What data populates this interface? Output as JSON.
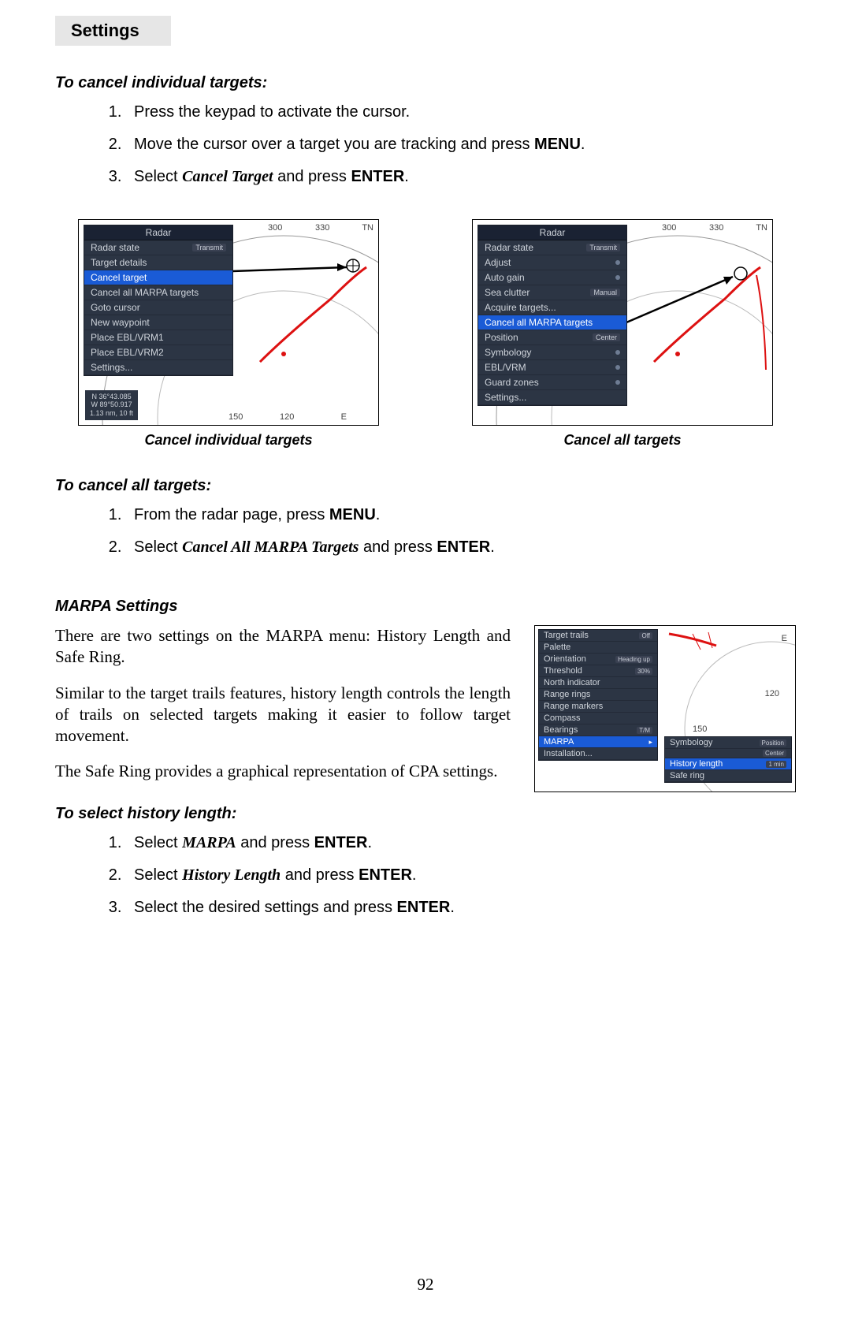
{
  "header": {
    "tab": "Settings"
  },
  "proc1": {
    "heading": "To cancel individual targets:",
    "s1": "Press the keypad to activate the cursor.",
    "s2a": "Move the cursor over a target you are tracking and press ",
    "s2b": "MENU",
    "s2c": ".",
    "s3a": "Select ",
    "s3b": "Cancel Target",
    "s3c": " and press ",
    "s3d": "ENTER",
    "s3e": "."
  },
  "fig": {
    "left_caption": "Cancel individual targets",
    "right_caption": "Cancel all targets",
    "left_menu": {
      "title": "Radar",
      "i0": "Radar state",
      "i0v": "Transmit",
      "i1": "Target details",
      "i2": "Cancel target",
      "i3": "Cancel all MARPA targets",
      "i4": "Goto cursor",
      "i5": "New waypoint",
      "i6": "Place EBL/VRM1",
      "i7": "Place EBL/VRM2",
      "i8": "Settings..."
    },
    "left_info": {
      "l1": "N  36°43.085",
      "l2": "W  89°50.917",
      "l3": "1.13 nm, 10 ft"
    },
    "left_ticks": {
      "a": "300",
      "b": "330",
      "c": "150",
      "d": "120",
      "e": "E",
      "tn": "TN"
    },
    "right_menu": {
      "title": "Radar",
      "i0": "Radar state",
      "i0v": "Transmit",
      "i1": "Adjust",
      "i2": "Auto gain",
      "i3": "Sea clutter",
      "i3v": "Manual",
      "i4": "Acquire targets...",
      "i5": "Cancel all MARPA targets",
      "i6": "Position",
      "i6v": "Center",
      "i7": "Symbology",
      "i8": "EBL/VRM",
      "i9": "Guard zones",
      "i10": "Settings..."
    },
    "right_ticks": {
      "a": "300",
      "b": "330",
      "tn": "TN"
    }
  },
  "proc2": {
    "heading": "To cancel all targets:",
    "s1a": "From the radar page, press ",
    "s1b": "MENU",
    "s1c": ".",
    "s2a": "Select ",
    "s2b": "Cancel All MARPA Targets",
    "s2c": " and press ",
    "s2d": "ENTER",
    "s2e": "."
  },
  "marpa": {
    "heading": "MARPA Settings",
    "p1": "There are two settings on the MARPA menu: History Length and Safe Ring.",
    "p2": "Similar to the target trails features, history length controls the length of trails on selected targets making it easier to follow target movement.",
    "p3": "The Safe Ring provides a graphical representation of CPA settings.",
    "menu": {
      "i0": "Target trails",
      "i0v": "Off",
      "i1": "Palette",
      "i2": "Orientation",
      "i2v": "Heading up",
      "i3": "Threshold",
      "i3v": "30%",
      "i4": "North indicator",
      "i5": "Range rings",
      "i6": "Range markers",
      "i7": "Compass",
      "i8": "Bearings",
      "i8v": "T/M",
      "i9": "MARPA",
      "i10": "Installation..."
    },
    "submenu": {
      "s0": "Symbology",
      "s0v": "Position",
      "s0b": "Center",
      "s1": "History length",
      "s1v": "1 min",
      "s2": "Safe ring"
    },
    "ticks": {
      "a": "120",
      "b": "150",
      "e": "E"
    }
  },
  "proc3": {
    "heading": "To select history length:",
    "s1a": "Select ",
    "s1b": "MARPA",
    "s1c": " and press ",
    "s1d": "ENTER",
    "s1e": ".",
    "s2a": "Select ",
    "s2b": "History Length",
    "s2c": " and press ",
    "s2d": "ENTER",
    "s2e": ".",
    "s3a": "Select the desired settings and press ",
    "s3b": "ENTER",
    "s3c": "."
  },
  "page_number": "92"
}
